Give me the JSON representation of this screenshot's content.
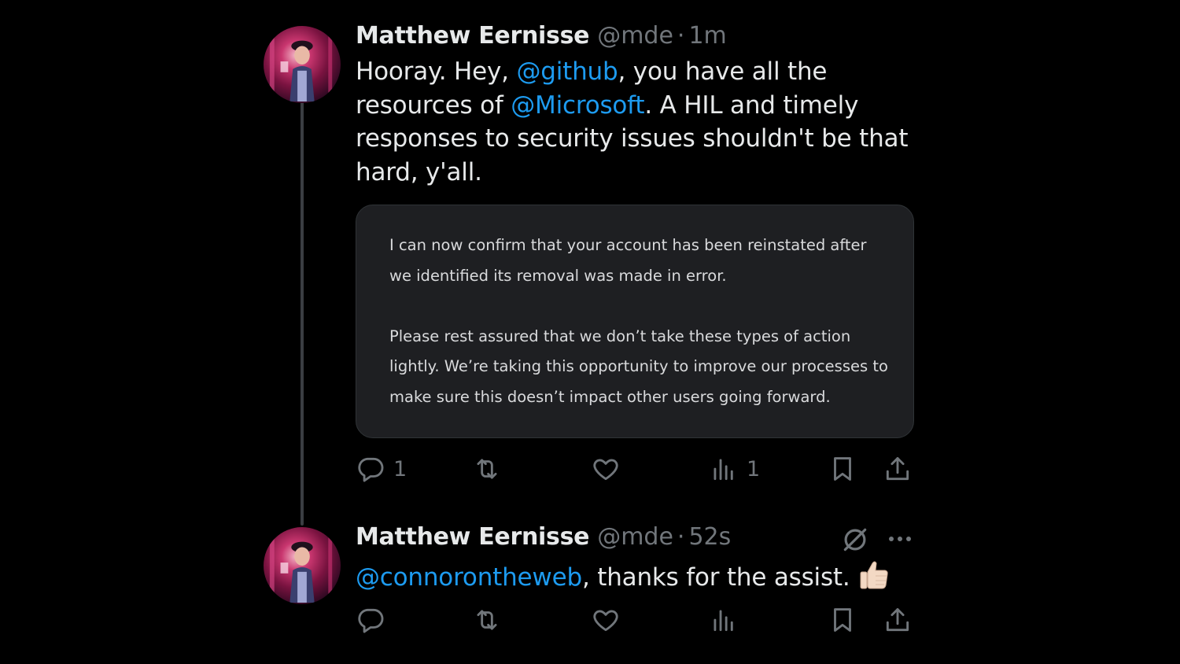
{
  "colors": {
    "background": "#000000",
    "text": "#e7e9ea",
    "muted": "#71767b",
    "link": "#1d9bf0",
    "card": "#1e1f22"
  },
  "tweet1": {
    "name": "Matthew Eernisse",
    "handle": "@mde",
    "separator": "·",
    "time": "1m",
    "text": {
      "p1": "Hooray. Hey, ",
      "mention1": "@github",
      "p2": ", you have all the resources of ",
      "mention2": "@Microsoft",
      "p3": ". A HIL and timely responses to security issues shouldn't be that hard, y'all."
    },
    "quoted_card": {
      "paragraph1": "I can now confirm that your account has been reinstated after we identified its removal was made in error.",
      "paragraph2": "Please rest assured that we don’t take these types of action lightly. We’re taking this opportunity to improve our processes to make sure this doesn’t impact other users going forward."
    },
    "actions": {
      "reply_icon": "reply-icon",
      "reply_count": "1",
      "repost_icon": "repost-icon",
      "like_icon": "heart-icon",
      "views_icon": "views-icon",
      "views_count": "1",
      "bookmark_icon": "bookmark-icon",
      "share_icon": "share-icon"
    }
  },
  "tweet2": {
    "name": "Matthew Eernisse",
    "handle": "@mde",
    "separator": "·",
    "time": "52s",
    "text": {
      "mention": "@connorontheweb",
      "rest": ", thanks for the assist.",
      "emoji": "thumbs-up-emoji"
    },
    "top_right_icons": [
      "grok-icon",
      "more-icon"
    ],
    "actions": {
      "reply_icon": "reply-icon",
      "repost_icon": "repost-icon",
      "like_icon": "heart-icon",
      "views_icon": "views-icon",
      "bookmark_icon": "bookmark-icon",
      "share_icon": "share-icon"
    }
  }
}
